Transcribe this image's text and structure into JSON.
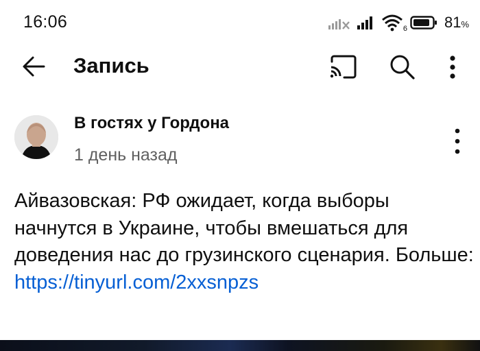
{
  "status_bar": {
    "time": "16:06",
    "battery_percent": "81",
    "battery_unit": "%",
    "wifi_label": "6",
    "icons": [
      "signal-off-icon",
      "signal-icon",
      "wifi-icon",
      "battery-icon"
    ]
  },
  "app_bar": {
    "title": "Запись",
    "icons": [
      "back-arrow-icon",
      "cast-icon",
      "search-icon",
      "more-vert-icon"
    ]
  },
  "post": {
    "channel": "В гостях у Гордона",
    "age": "1 день назад",
    "text": "Айвазовская: РФ ожидает, когда выборы начнутся в Украине, чтобы вмешаться для доведения нас до грузинского сценария. Больше:",
    "link": "https://tinyurl.com/2xxsnpzs"
  },
  "colors": {
    "link": "#065fd4",
    "secondary_text": "#606060",
    "primary_text": "#0f0f0f"
  }
}
